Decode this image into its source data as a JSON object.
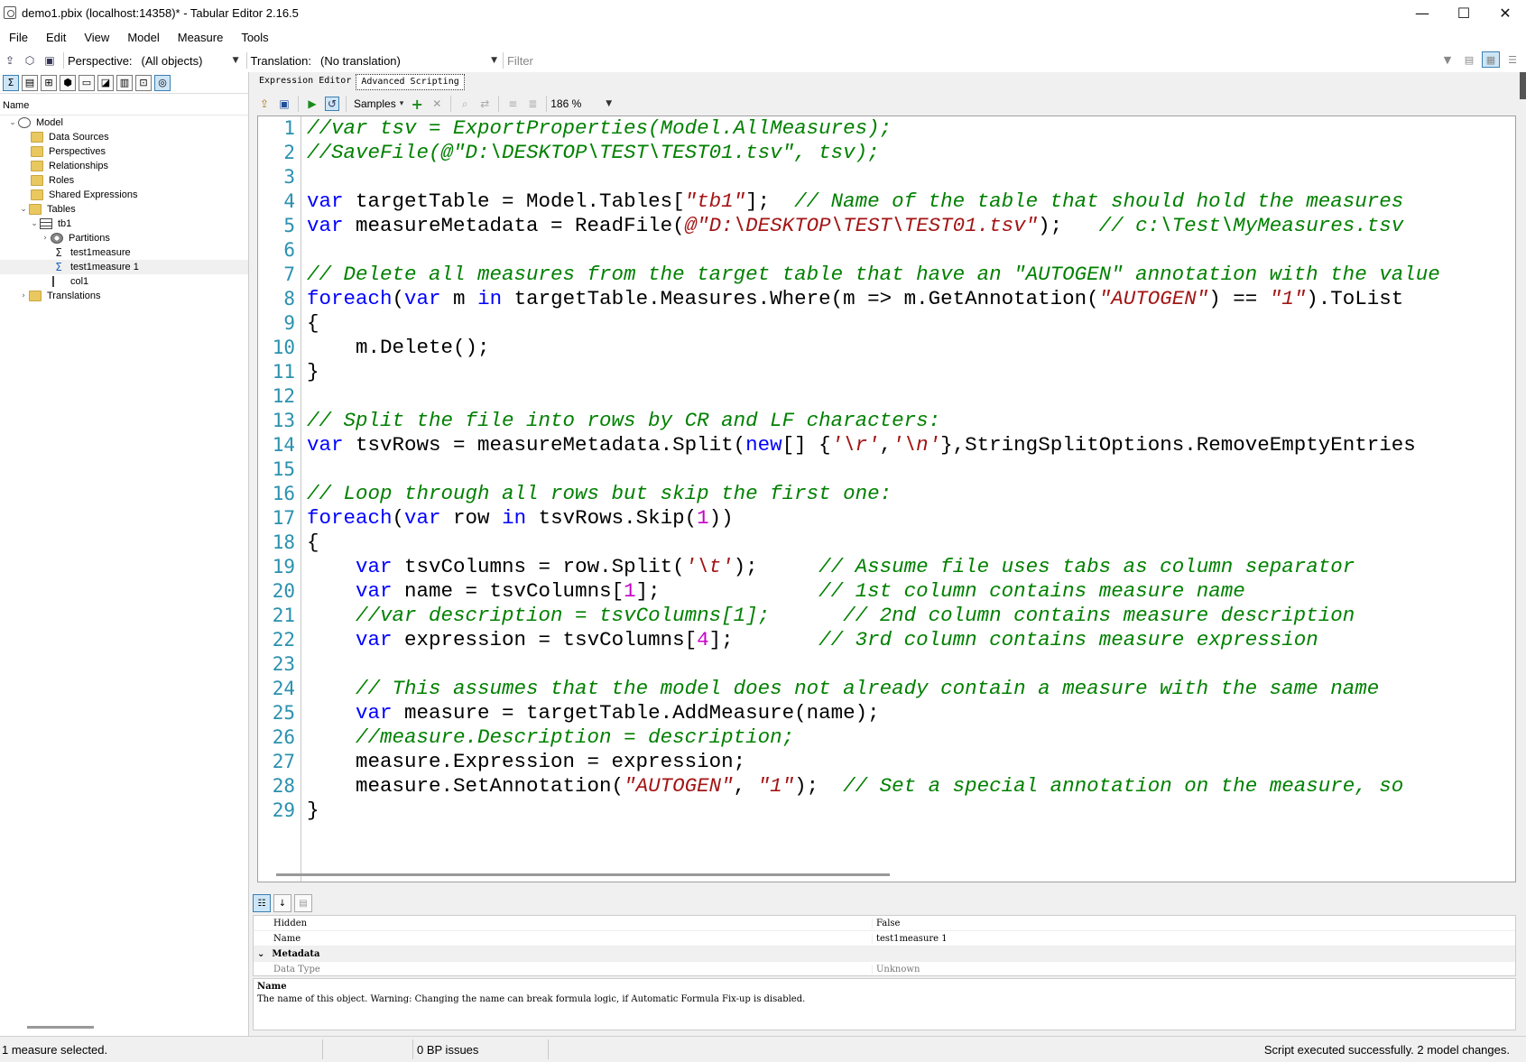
{
  "window": {
    "title": "demo1.pbix (localhost:14358)* - Tabular Editor 2.16.5",
    "minimize": "—",
    "maximize": "☐",
    "close": "✕"
  },
  "menu": [
    "File",
    "Edit",
    "View",
    "Model",
    "Measure",
    "Tools"
  ],
  "toolbar": {
    "perspective_label": "Perspective:",
    "perspective_value": "(All objects)",
    "translation_label": "Translation:",
    "translation_value": "(No translation)",
    "filter_placeholder": "Filter"
  },
  "tree": {
    "header": "Name",
    "nodes": [
      {
        "label": "Model"
      },
      {
        "label": "Data Sources"
      },
      {
        "label": "Perspectives"
      },
      {
        "label": "Relationships"
      },
      {
        "label": "Roles"
      },
      {
        "label": "Shared Expressions"
      },
      {
        "label": "Tables"
      },
      {
        "label": "tb1"
      },
      {
        "label": "Partitions"
      },
      {
        "label": "test1measure"
      },
      {
        "label": "test1measure 1"
      },
      {
        "label": "col1"
      },
      {
        "label": "Translations"
      }
    ]
  },
  "editor": {
    "tabs": [
      "Expression Editor",
      "Advanced Scripting"
    ],
    "active_tab": "Advanced Scripting",
    "samples_label": "Samples",
    "zoom": "186 %"
  },
  "code_lines": [
    "//var tsv = ExportProperties(Model.AllMeasures);",
    "//SaveFile(@\"D:\\DESKTOP\\TEST\\TEST01.tsv\", tsv);",
    "",
    "var targetTable = Model.Tables[\"tb1\"];  // Name of the table that should hold the measures",
    "var measureMetadata = ReadFile(@\"D:\\DESKTOP\\TEST\\TEST01.tsv\");   // c:\\Test\\MyMeasures.tsv",
    "",
    "// Delete all measures from the target table that have an \"AUTOGEN\" annotation with the value",
    "foreach(var m in targetTable.Measures.Where(m => m.GetAnnotation(\"AUTOGEN\") == \"1\").ToList",
    "{",
    "    m.Delete();",
    "}",
    "",
    "// Split the file into rows by CR and LF characters:",
    "var tsvRows = measureMetadata.Split(new[] {'\\r','\\n'},StringSplitOptions.RemoveEmptyEntries",
    "",
    "// Loop through all rows but skip the first one:",
    "foreach(var row in tsvRows.Skip(1))",
    "{",
    "    var tsvColumns = row.Split('\\t');     // Assume file uses tabs as column separator",
    "    var name = tsvColumns[1];             // 1st column contains measure name",
    "    //var description = tsvColumns[1];      // 2nd column contains measure description",
    "    var expression = tsvColumns[4];       // 3rd column contains measure expression",
    "",
    "    // This assumes that the model does not already contain a measure with the same name",
    "    var measure = targetTable.AddMeasure(name);",
    "    //measure.Description = description;",
    "    measure.Expression = expression;",
    "    measure.SetAnnotation(\"AUTOGEN\", \"1\");  // Set a special annotation on the measure, so",
    "}"
  ],
  "properties": {
    "rows": [
      {
        "key": "Hidden",
        "value": "False"
      },
      {
        "key": "Name",
        "value": "test1measure 1"
      }
    ],
    "category": "Metadata",
    "partial_row": {
      "key": "Data Type",
      "value": "Unknown"
    },
    "description_title": "Name",
    "description_text": "The name of this object. Warning: Changing the name can break formula logic, if Automatic Formula Fix-up is disabled."
  },
  "status": {
    "selection": "1 measure selected.",
    "bp_issues": "0 BP issues",
    "result": "Script executed successfully. 2 model changes."
  }
}
